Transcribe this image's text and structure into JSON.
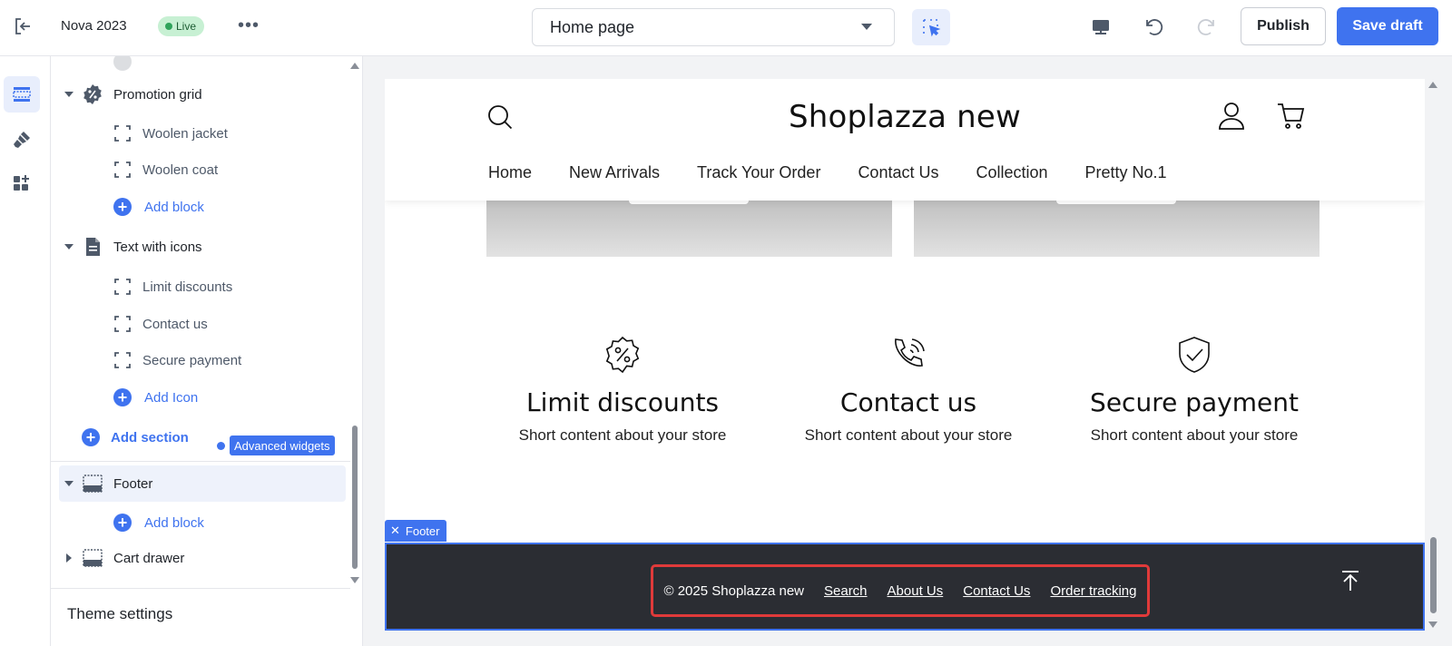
{
  "topbar": {
    "theme_name": "Nova 2023",
    "status": "Live",
    "page_select": "Home page",
    "publish_label": "Publish",
    "save_label": "Save draft"
  },
  "panel": {
    "sections": [
      {
        "name": "Promotion grid",
        "blocks": [
          "Woolen jacket",
          "Woolen coat"
        ],
        "add_label": "Add block"
      },
      {
        "name": "Text with icons",
        "blocks": [
          "Limit discounts",
          "Contact us",
          "Secure payment"
        ],
        "add_label": "Add Icon"
      }
    ],
    "add_section": "Add section",
    "advanced_widgets": "Advanced widgets",
    "footer": {
      "name": "Footer",
      "add_label": "Add block"
    },
    "cart_drawer": "Cart drawer",
    "theme_settings": "Theme settings"
  },
  "preview": {
    "store_title": "Shoplazza new",
    "nav": [
      "Home",
      "New Arrivals",
      "Track Your Order",
      "Contact Us",
      "Collection",
      "Pretty No.1"
    ],
    "features": [
      {
        "title": "Limit discounts",
        "text": "Short content about your store",
        "icon": "discount-badge-icon"
      },
      {
        "title": "Contact us",
        "text": "Short content about your store",
        "icon": "phone-call-icon"
      },
      {
        "title": "Secure payment",
        "text": "Short content about your store",
        "icon": "shield-check-icon"
      }
    ],
    "footer_tag": "Footer",
    "footer": {
      "copyright": "© 2025 Shoplazza new",
      "links": [
        "Search",
        "About Us",
        "Contact Us",
        "Order tracking"
      ]
    }
  },
  "colors": {
    "accent": "#3f73ef",
    "live_bg": "#c7f0d3",
    "footer_bg": "#2b2d33",
    "highlight": "#e03a3a"
  }
}
